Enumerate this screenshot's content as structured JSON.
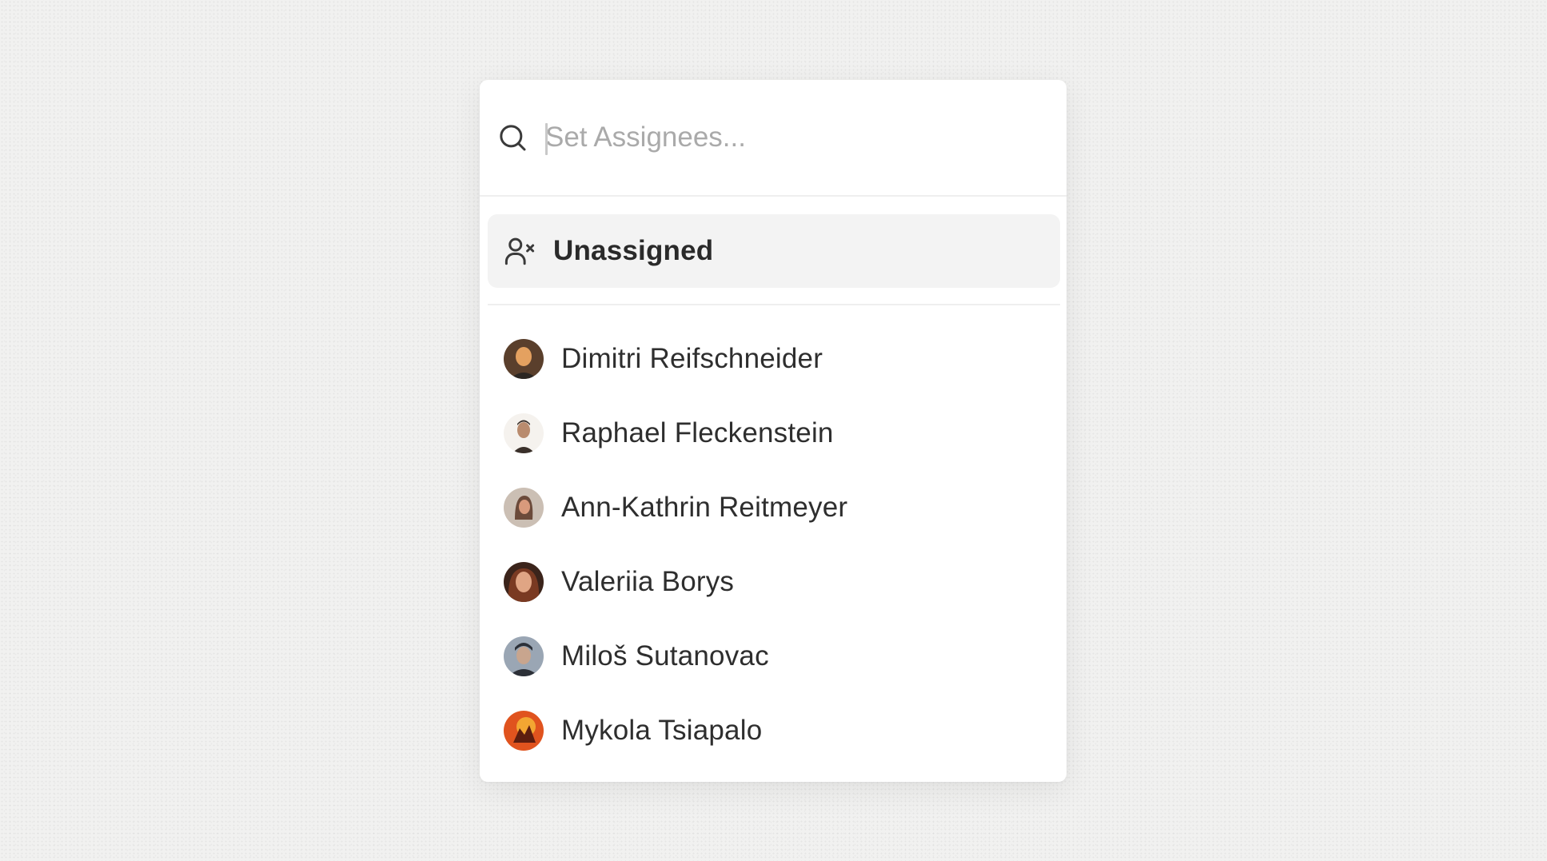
{
  "search": {
    "placeholder": "Set Assignees...",
    "icon": "search-icon"
  },
  "unassigned": {
    "label": "Unassigned",
    "icon": "user-x-icon"
  },
  "users": [
    {
      "name": "Dimitri Reifschneider",
      "avatar_colors": [
        "#5a3f2c",
        "#e4a160",
        "#2b2622"
      ]
    },
    {
      "name": "Raphael Fleckenstein",
      "avatar_colors": [
        "#f5f2ee",
        "#b98b6e",
        "#3a302a"
      ]
    },
    {
      "name": "Ann-Kathrin Reitmeyer",
      "avatar_colors": [
        "#cbbfb4",
        "#d89a7c",
        "#6b4a3a"
      ]
    },
    {
      "name": "Valeriia Borys",
      "avatar_colors": [
        "#3b241b",
        "#e0a584",
        "#7a3a22"
      ]
    },
    {
      "name": "Miloš Sutanovac",
      "avatar_colors": [
        "#9aa6b4",
        "#c8a58e",
        "#2c3038"
      ]
    },
    {
      "name": "Mykola Tsiapalo",
      "avatar_colors": [
        "#e0531e",
        "#f3a632",
        "#5c1d0f"
      ]
    }
  ],
  "colors": {
    "background": "#f1f1f0",
    "panel": "#ffffff",
    "highlight": "#f3f3f3",
    "text": "#2e2e2e",
    "placeholder": "#aaaaaa"
  }
}
